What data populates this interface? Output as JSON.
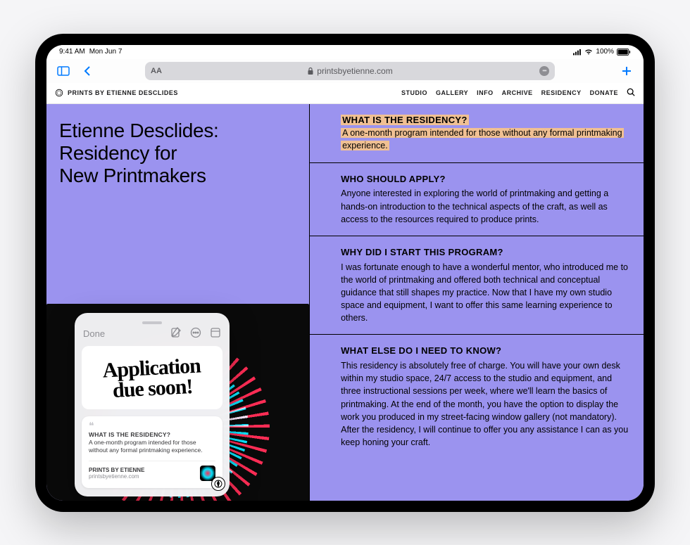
{
  "status": {
    "time": "9:41 AM",
    "date": "Mon Jun 7",
    "battery_pct": "100%"
  },
  "safari": {
    "url": "printsbyetienne.com",
    "text_size_label": "AA"
  },
  "site": {
    "brand": "PRINTS BY ETIENNE DESCLIDES",
    "nav": [
      "STUDIO",
      "GALLERY",
      "INFO",
      "ARCHIVE",
      "RESIDENCY",
      "DONATE"
    ]
  },
  "page": {
    "title": "Etienne Desclides:\nResidency for\nNew Printmakers",
    "faq": [
      {
        "q": "WHAT IS THE RESIDENCY?",
        "a": "A one-month program intended for those without any formal printmaking experience.",
        "highlighted": true
      },
      {
        "q": "WHO SHOULD APPLY?",
        "a": "Anyone interested in exploring the world of printmaking and getting a hands-on introduction to the technical aspects of the craft, as well as access to the resources required to produce prints."
      },
      {
        "q": "WHY DID I START THIS PROGRAM?",
        "a": "I was fortunate enough to have a wonderful mentor, who introduced me to the world of printmaking and offered both technical and conceptual guidance that still shapes my practice. Now that I have my own studio space and equipment, I want to offer this same learning experience to others."
      },
      {
        "q": "WHAT ELSE DO I NEED TO KNOW?",
        "a": "This residency is absolutely free of charge. You will have your own desk within my studio space, 24/7 access to the studio and equipment, and three instructional sessions per week, where we'll learn the basics of printmaking. At the end of the month, you have the option to display the work you produced in my street-facing window gallery (not mandatory). After the residency, I will continue to offer you any assistance I can as you keep honing your craft."
      }
    ]
  },
  "quicknote": {
    "done": "Done",
    "handwriting": "Application due soon!",
    "clip_title": "WHAT IS THE RESIDENCY?",
    "clip_body": "A one-month program intended for those without any formal printmaking experience.",
    "clip_source_name": "PRINTS BY ETIENNE",
    "clip_source_url": "printsbyetienne.com"
  }
}
